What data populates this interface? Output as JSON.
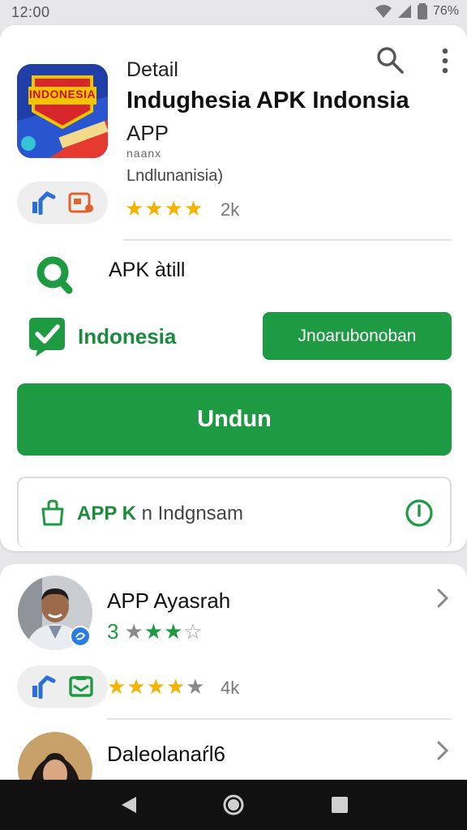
{
  "status_bar": {
    "time": "12:00",
    "battery": "76%",
    "icons": [
      "wifi-icon",
      "signal-icon",
      "battery-icon"
    ]
  },
  "header": {
    "back_icon": "back-arrow-icon",
    "search_icon": "search-icon",
    "more_icon": "more-vert-icon",
    "detail_label": "Detail",
    "logo_text": "INDONESIA"
  },
  "app": {
    "title": "Indughesia APK Indonsia",
    "type": "APP",
    "sub_label": "naanx",
    "region": "Lndlunanisia)",
    "rating_stars": 4,
    "rating_count": "2k"
  },
  "info_rows": {
    "search_label": "APK àtill",
    "region_label": "Indonesia",
    "action_button": "Jnoarubonoban"
  },
  "install_button": "Undun",
  "apk_box": {
    "strong": "APP K",
    "rest": " n Indgnsam"
  },
  "list": [
    {
      "title": "APP Ayasrah",
      "rating_value": "3",
      "rating_stars": 3
    },
    {
      "rating_stars": 4,
      "rating_count": "4k"
    },
    {
      "title": "Daleolanaŕl6"
    }
  ],
  "colors": {
    "accent": "#1e9a43",
    "star": "#f3b300",
    "text": "#111111"
  }
}
